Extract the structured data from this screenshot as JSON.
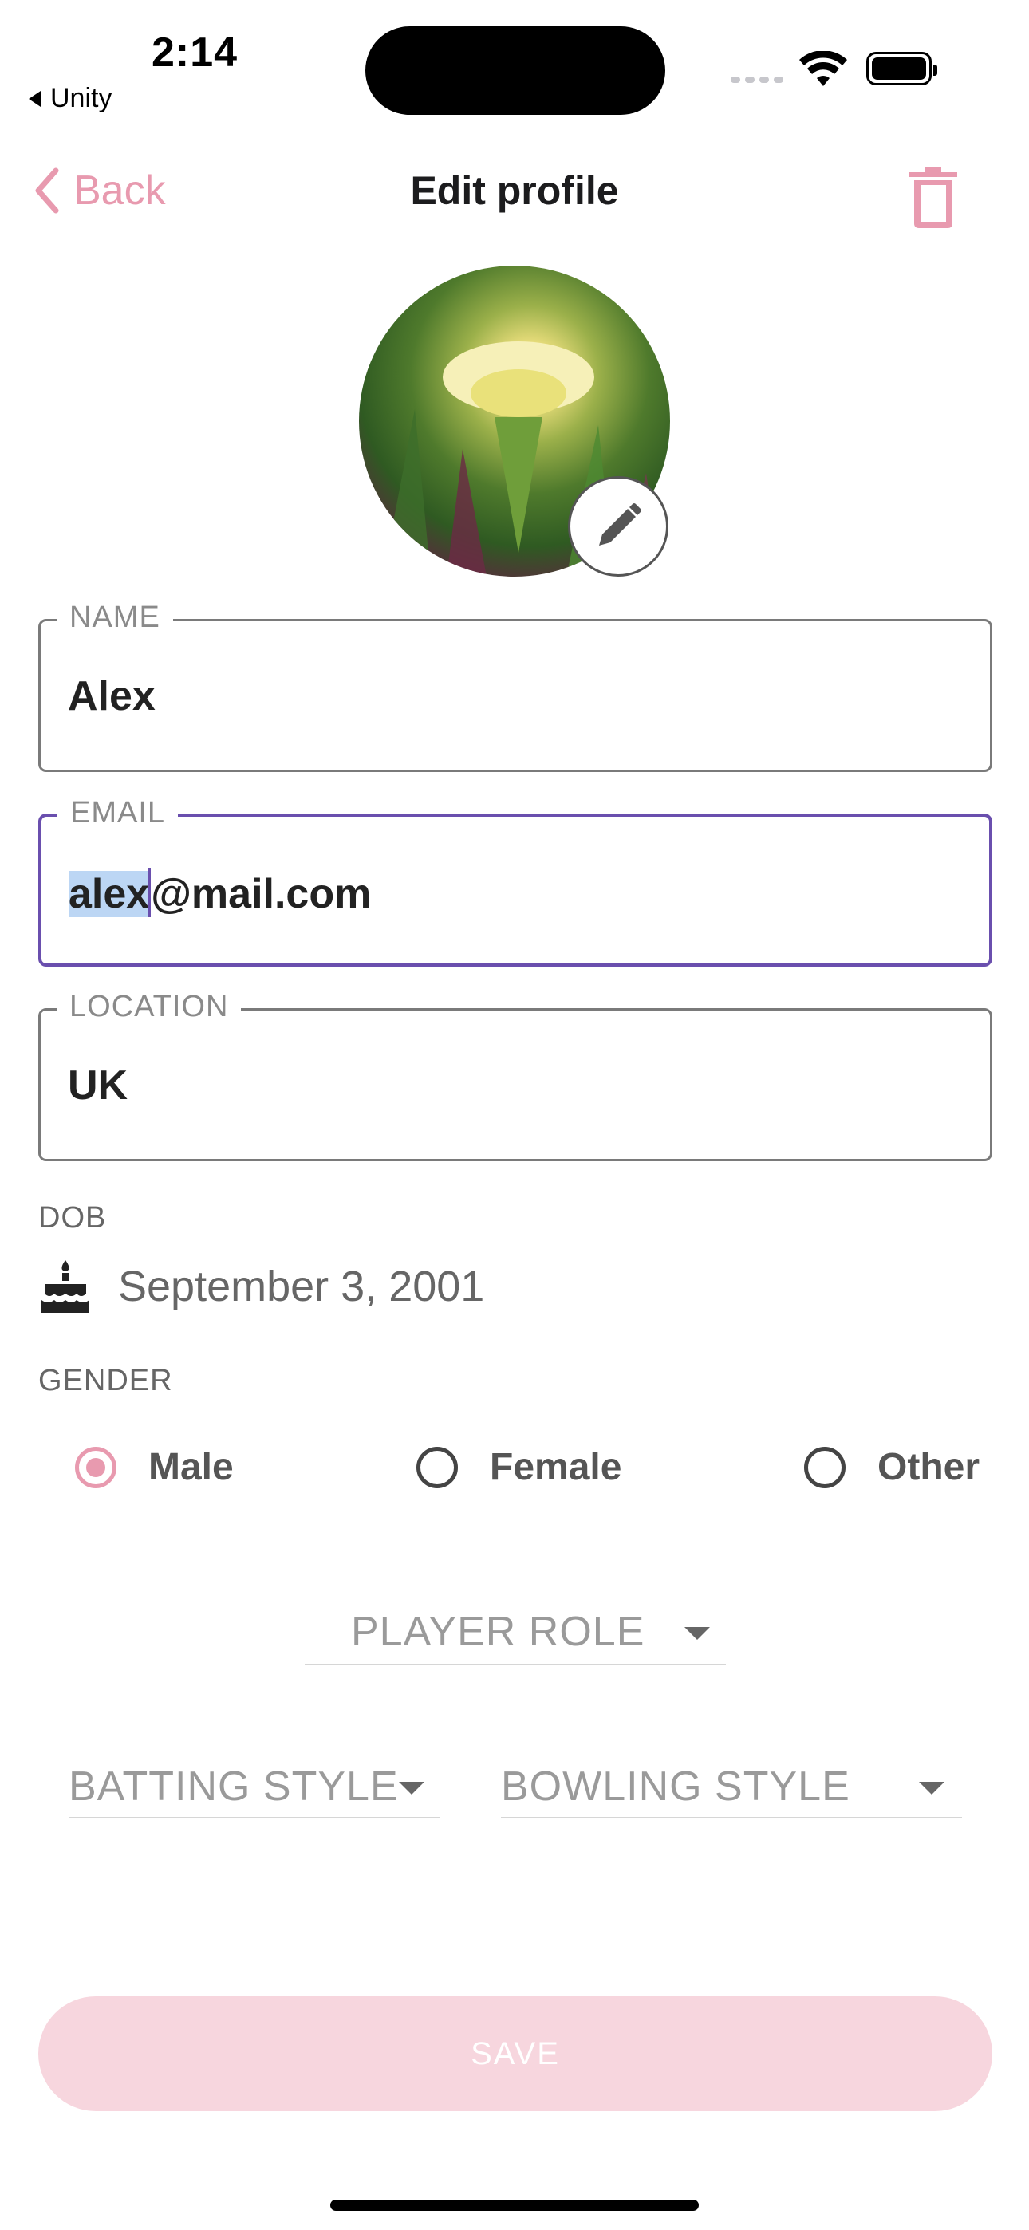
{
  "status_bar": {
    "time": "2:14",
    "back_app": "Unity"
  },
  "nav": {
    "back_label": "Back",
    "title": "Edit profile",
    "back_icon": "chevron-left-icon",
    "delete_icon": "trash-icon"
  },
  "avatar": {
    "edit_icon": "pencil-icon"
  },
  "form": {
    "name": {
      "label": "NAME",
      "value": "Alex"
    },
    "email": {
      "label": "EMAIL",
      "value_selected": "alex",
      "value_rest": "@mail.com"
    },
    "location": {
      "label": "LOCATION",
      "value": "UK"
    },
    "dob": {
      "label": "DOB",
      "value": "September 3, 2001",
      "icon": "cake-icon"
    },
    "gender": {
      "label": "GENDER",
      "options": [
        "Male",
        "Female",
        "Other"
      ],
      "selected": "Male"
    },
    "player_role": {
      "placeholder": "PLAYER ROLE"
    },
    "batting_style": {
      "placeholder": "BATTING STYLE"
    },
    "bowling_style": {
      "placeholder": "BOWLING STYLE"
    }
  },
  "save_label": "SAVE",
  "colors": {
    "accent": "#e89aaf",
    "focus": "#6a4fae",
    "save_bg": "#f7d6de"
  }
}
